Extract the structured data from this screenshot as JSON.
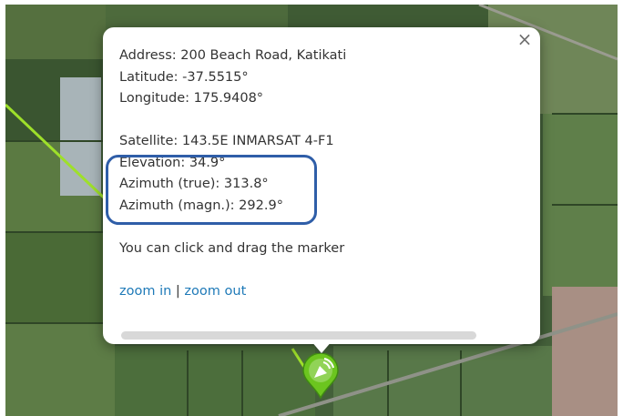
{
  "popup": {
    "close_icon": "close-icon",
    "address": "Address: 200 Beach Road, Katikati",
    "latitude": "Latitude: -37.5515°",
    "longitude": "Longitude: 175.9408°",
    "satellite": "Satellite: 143.5E INMARSAT 4-F1",
    "elevation": "Elevation: 34.9°",
    "azimuth_true": "Azimuth (true): 313.8°",
    "azimuth_magn": "Azimuth (magn.): 292.9°",
    "hint": "You can click and drag the marker",
    "zoom_in": "zoom in",
    "separator": " | ",
    "zoom_out": "zoom out"
  },
  "map": {
    "imagery": "satellite",
    "marker_icon": "satellite-dish-marker-icon",
    "line_color": "#9ee02a",
    "marker_color": "#6cc51f"
  },
  "annotation": {
    "color": "#2f5ea8"
  }
}
